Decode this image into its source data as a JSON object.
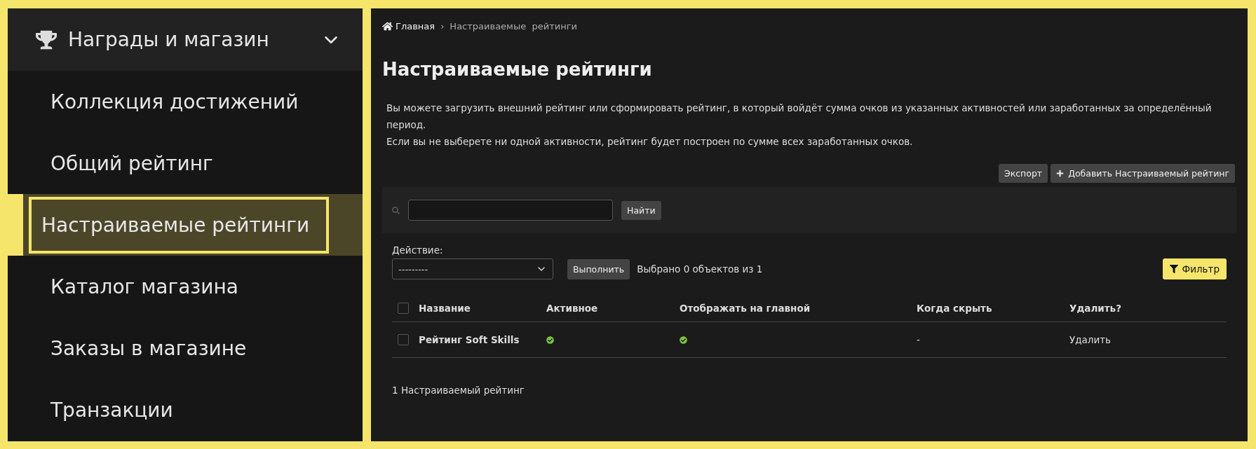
{
  "sidebar": {
    "section": {
      "title": "Награды и магазин",
      "expanded": true
    },
    "items": [
      {
        "label": "Коллекция достижений",
        "selected": false
      },
      {
        "label": "Общий рейтинг",
        "selected": false
      },
      {
        "label": "Настраиваемые рейтинги",
        "selected": true
      },
      {
        "label": "Каталог магазина",
        "selected": false
      },
      {
        "label": "Заказы в магазине",
        "selected": false
      },
      {
        "label": "Транзакции",
        "selected": false
      }
    ]
  },
  "breadcrumbs": [
    {
      "label": "Главная",
      "kind": "home"
    },
    {
      "label": "›",
      "kind": "separator"
    },
    {
      "label": "Настраиваемые  рейтинги",
      "kind": "current"
    }
  ],
  "title": "Настраиваемые рейтинги",
  "description": [
    "Вы можете загрузить внешний рейтинг или сформировать рейтинг, в который войдёт сумма очков из указанных активностей или заработанных за определённый период.",
    "Если вы не выберете ни одной активности, рейтинг будет построен по сумме всех заработанных очков."
  ],
  "toolbar": [
    {
      "label": "Экспорт",
      "kind": "plain"
    },
    {
      "label": "Добавить Настраиваемый рейтинг",
      "kind": "add"
    }
  ],
  "search": {
    "button": "Найти"
  },
  "actions": {
    "label": "Действие:",
    "select": "---------",
    "button": "Выполнить",
    "selection_text": "Выбрано 0 объектов из 1",
    "filter_button": "Фильтр"
  },
  "table": {
    "select_all_checked": false,
    "columns": [
      "Название",
      "Активное",
      "Отображать на главной",
      "Когда скрыть",
      "Удалить?"
    ],
    "rows": [
      {
        "checked": false,
        "name": "Рейтинг Soft Skills",
        "active": true,
        "show_on_main": true,
        "hide_when": "-",
        "delete": "Удалить"
      }
    ]
  },
  "footer": "1 Настраиваемый рейтинг"
}
